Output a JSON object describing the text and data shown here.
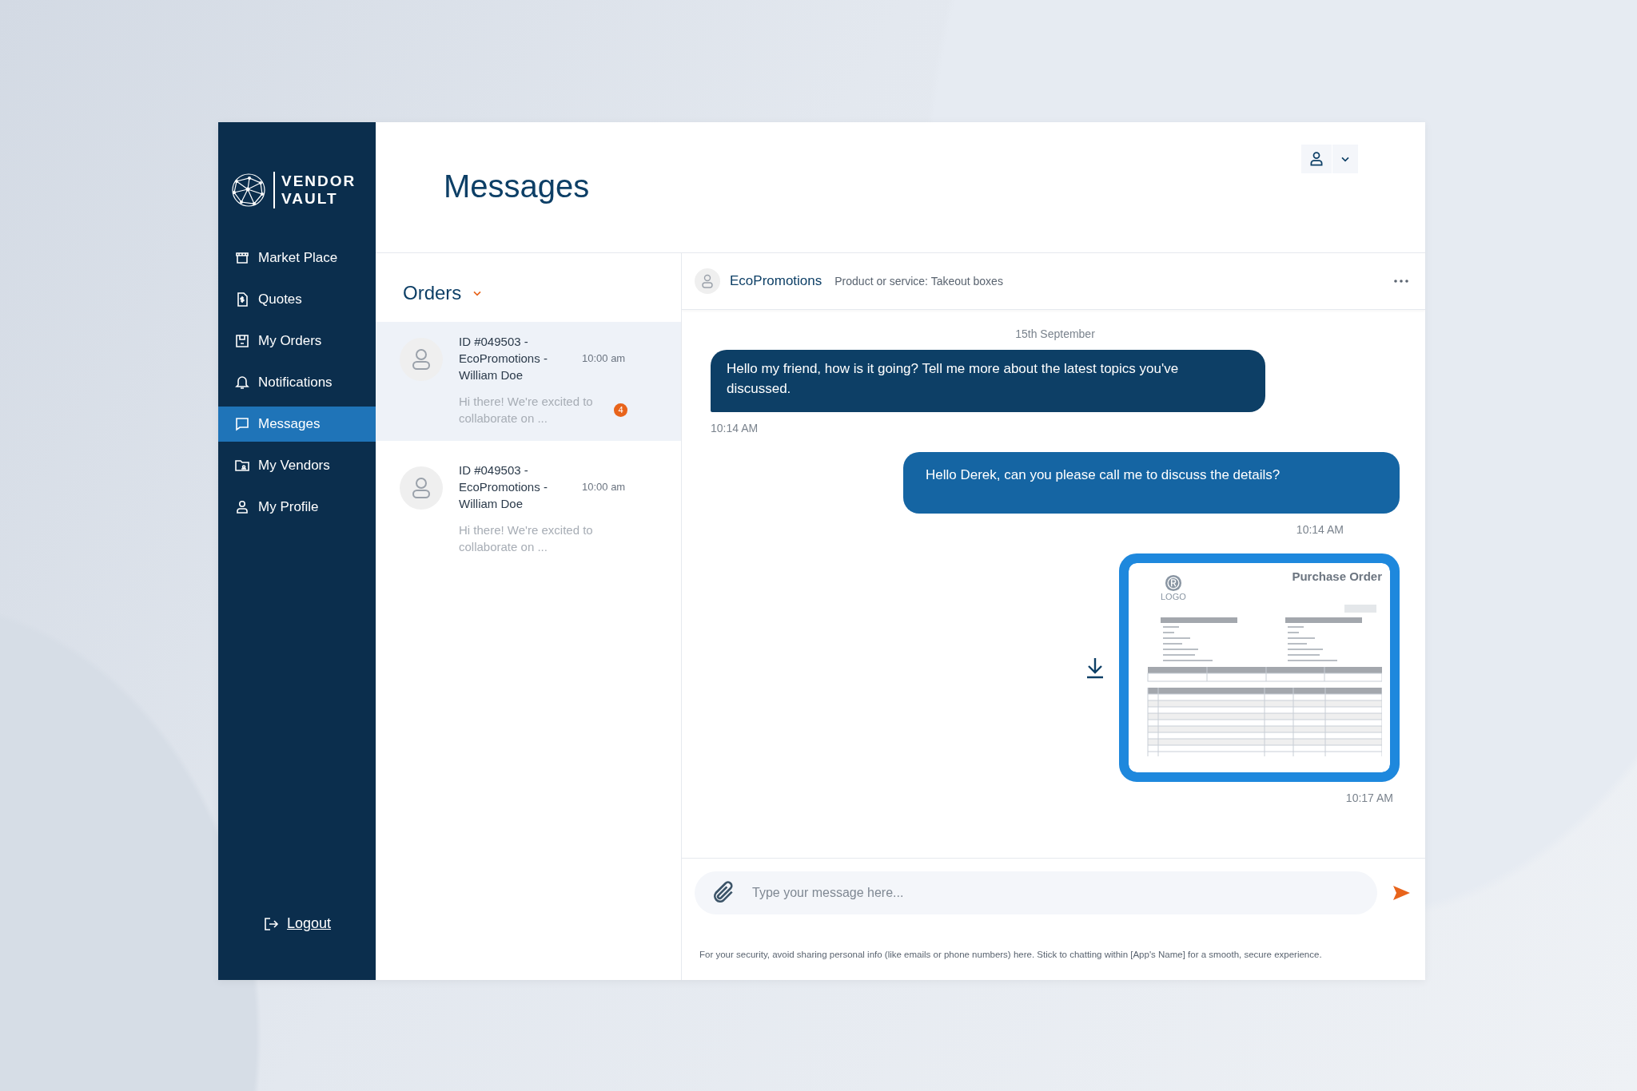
{
  "brand": {
    "line1": "VENDOR",
    "line2": "VAULT"
  },
  "nav": [
    {
      "label": "Market Place",
      "selected": false
    },
    {
      "label": "Quotes",
      "selected": false
    },
    {
      "label": "My Orders",
      "selected": false
    },
    {
      "label": "Notifications",
      "selected": false
    },
    {
      "label": "Messages",
      "selected": true
    },
    {
      "label": "My Vendors",
      "selected": false
    },
    {
      "label": "My Profile",
      "selected": false
    }
  ],
  "logout": "Logout",
  "page_title": "Messages",
  "list": {
    "title": "Orders",
    "items": [
      {
        "title": "ID #049503 - EcoPromotions - William Doe",
        "time": "10:00 am",
        "preview": "Hi there! We're excited to collaborate on ...",
        "badge": "4",
        "selected": true
      },
      {
        "title": "ID #049503 - EcoPromotions - William Doe",
        "time": "10:00 am",
        "preview": "Hi there! We're excited to collaborate on ...",
        "selected": false
      }
    ]
  },
  "chat": {
    "name": "EcoPromotions",
    "subtitle": "Product or service: Takeout boxes",
    "date": "15th September",
    "messages": [
      {
        "kind": "incoming",
        "text": "Hello my friend, how is it going? Tell me more about the latest topics you've discussed.",
        "time": "10:14 AM"
      },
      {
        "kind": "outgoing",
        "text": "Hello Derek, can you please call me to discuss the details?",
        "time": "10:14 AM"
      },
      {
        "kind": "attachment",
        "time": "10:17 AM",
        "document": {
          "title": "Purchase Order",
          "logo": "LOGO"
        }
      }
    ],
    "input": {
      "placeholder": "Type your message here..."
    },
    "notice": "For your security, avoid sharing personal info (like emails or phone numbers) here. Stick to chatting within [App's Name] for a smooth, secure experience."
  }
}
